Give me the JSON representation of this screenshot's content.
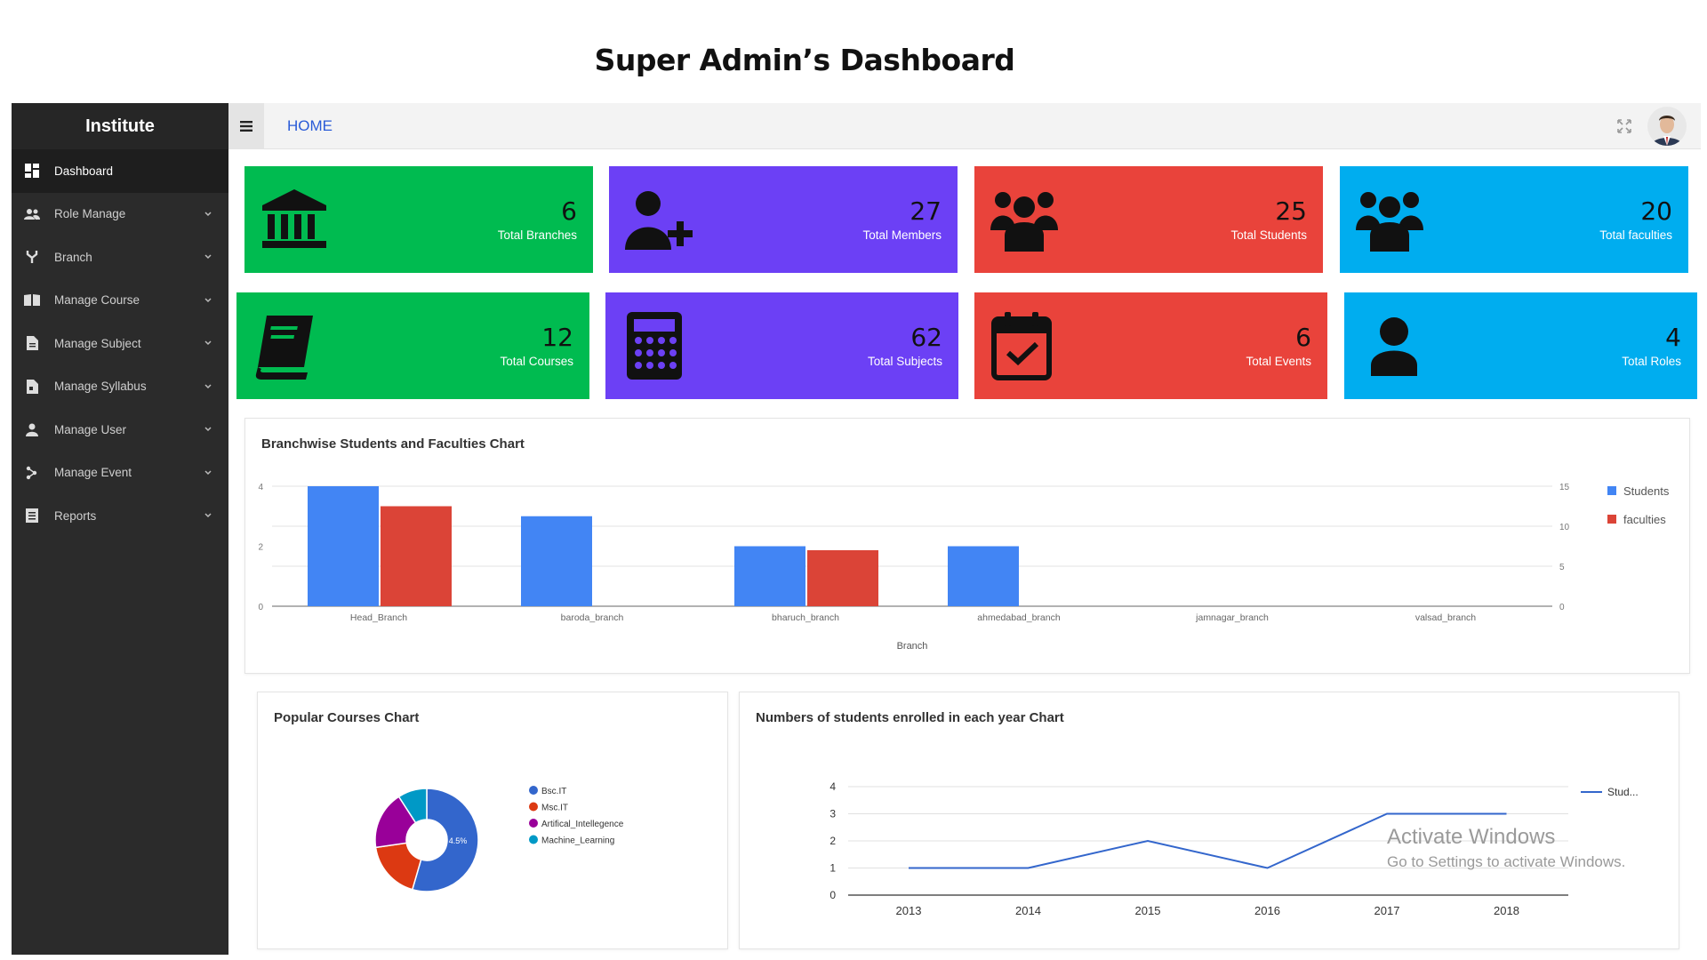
{
  "page_title": "Super Admin’s Dashboard",
  "sidebar": {
    "brand": "Institute",
    "items": [
      {
        "label": "Dashboard",
        "icon": "dashboard-icon",
        "active": true,
        "has_submenu": false
      },
      {
        "label": "Role Manage",
        "icon": "users-icon",
        "active": false,
        "has_submenu": true
      },
      {
        "label": "Branch",
        "icon": "branch-icon",
        "active": false,
        "has_submenu": true
      },
      {
        "label": "Manage Course",
        "icon": "book-open-icon",
        "active": false,
        "has_submenu": true
      },
      {
        "label": "Manage Subject",
        "icon": "document-icon",
        "active": false,
        "has_submenu": true
      },
      {
        "label": "Manage Syllabus",
        "icon": "syllabus-icon",
        "active": false,
        "has_submenu": true
      },
      {
        "label": "Manage User",
        "icon": "user-icon",
        "active": false,
        "has_submenu": true
      },
      {
        "label": "Manage Event",
        "icon": "event-icon",
        "active": false,
        "has_submenu": true
      },
      {
        "label": "Reports",
        "icon": "list-icon",
        "active": false,
        "has_submenu": true
      }
    ]
  },
  "topbar": {
    "breadcrumb": "HOME",
    "menu_icon": "hamburger-icon",
    "expand_icon": "expand-icon",
    "avatar_icon": "avatar-icon"
  },
  "cards": [
    {
      "value": "6",
      "label": "Total Branches",
      "color": "#00bb50",
      "icon": "institution-icon"
    },
    {
      "value": "27",
      "label": "Total Members",
      "color": "#6c40f5",
      "icon": "user-plus-icon"
    },
    {
      "value": "25",
      "label": "Total Students",
      "color": "#e9433b",
      "icon": "group-icon"
    },
    {
      "value": "20",
      "label": "Total faculties",
      "color": "#00adef",
      "icon": "group-icon"
    },
    {
      "value": "12",
      "label": "Total Courses",
      "color": "#00bb50",
      "icon": "book-icon"
    },
    {
      "value": "62",
      "label": "Total Subjects",
      "color": "#6c40f5",
      "icon": "calculator-icon"
    },
    {
      "value": "6",
      "label": "Total Events",
      "color": "#e9433b",
      "icon": "calendar-check-icon"
    },
    {
      "value": "4",
      "label": "Total Roles",
      "color": "#00adef",
      "icon": "person-icon"
    }
  ],
  "windows_watermark": {
    "line1": "Activate Windows",
    "line2": "Go to Settings to activate Windows."
  },
  "chart_data": [
    {
      "type": "bar",
      "title": "Branchwise Students and Faculties Chart",
      "xlabel": "Branch",
      "categories": [
        "Head_Branch",
        "baroda_branch",
        "bharuch_branch",
        "ahmedabad_branch",
        "jamnagar_branch",
        "valsad_branch"
      ],
      "series": [
        {
          "name": "Students",
          "values": [
            4,
            3,
            2,
            2,
            0,
            0
          ],
          "color": "#4285f4",
          "axis": "left"
        },
        {
          "name": "faculties",
          "values": [
            12.5,
            0,
            7,
            0,
            0,
            0
          ],
          "color": "#db4437",
          "axis": "right"
        }
      ],
      "left_axis": {
        "ylim": [
          0,
          4
        ],
        "ticks": [
          0,
          2,
          4
        ]
      },
      "right_axis": {
        "ylim": [
          0,
          15
        ],
        "ticks": [
          0,
          5,
          10,
          15
        ]
      },
      "legend": "right",
      "grid": true
    },
    {
      "type": "pie",
      "title": "Popular Courses Chart",
      "donut": true,
      "categories": [
        "Bsc.IT",
        "Msc.IT",
        "Artifical_Intellegence",
        "Machine_Learning"
      ],
      "values": [
        54.5,
        18.2,
        18.2,
        9.1
      ],
      "colors": [
        "#3366cc",
        "#dc3912",
        "#990099",
        "#0099c6"
      ],
      "slice_label": "4.5%",
      "legend": "right"
    },
    {
      "type": "line",
      "title": "Numbers of students enrolled in each year Chart",
      "x": [
        "2013",
        "2014",
        "2015",
        "2016",
        "2017",
        "2018"
      ],
      "series": [
        {
          "name": "Stud...",
          "values": [
            1,
            1,
            2,
            1,
            3,
            3
          ],
          "color": "#3366cc"
        }
      ],
      "ylim": [
        0,
        4
      ],
      "yticks": [
        0,
        1,
        2,
        3,
        4
      ],
      "legend": "right",
      "grid": true
    }
  ]
}
